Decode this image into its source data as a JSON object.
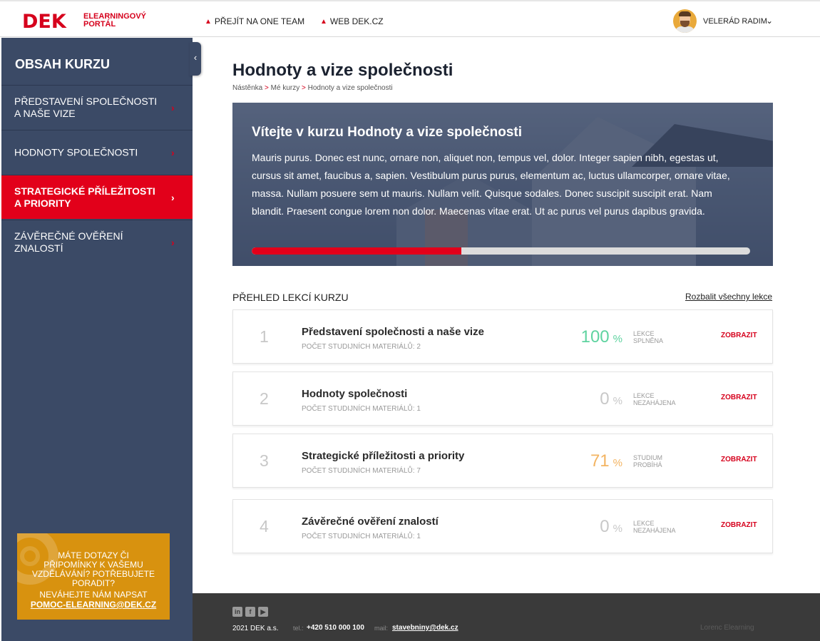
{
  "header": {
    "logo_text": "DEK",
    "portal_line1": "ELEARNINGOVÝ",
    "portal_line2": "PORTÁL",
    "links": [
      {
        "label": "PŘEJÍT NA ONE TEAM",
        "icon": "chevron-up-icon"
      },
      {
        "label": "WEB DEK.CZ",
        "icon": "chevron-up-icon"
      }
    ],
    "user_name": "VELERÁD RADIM",
    "user_menu_icon": "chevron-down-icon"
  },
  "sidebar": {
    "title": "OBSAH KURZU",
    "toggle_icon": "chevron-left-icon",
    "items": [
      {
        "label": "PŘEDSTAVENÍ SPOLEČNOSTI A NAŠE VIZE",
        "active": false
      },
      {
        "label": "HODNOTY SPOLEČNOSTI",
        "active": false
      },
      {
        "label": "STRATEGICKÉ PŘÍLEŽITOSTI A PRIORITY",
        "active": true
      },
      {
        "label": "ZÁVĚREČNÉ OVĚŘENÍ ZNALOSTÍ",
        "active": false
      }
    ],
    "help": {
      "question": "MÁTE DOTAZY ČI PŘIPOMÍNKY K VAŠEMU VZDĚLÁVÁNÍ? POTŘEBUJETE PORADIT?",
      "write_us": "NEVÁHEJTE NÁM NAPSAT",
      "email": "POMOC-ELEARNING@DEK.CZ"
    }
  },
  "main": {
    "title": "Hodnoty a vize společnosti",
    "breadcrumb": [
      "Nástěnka",
      "Mé kurzy",
      "Hodnoty a vize společnosti"
    ],
    "hero": {
      "title": "Vítejte v kurzu Hodnoty a vize společnosti",
      "text": "Mauris purus. Donec est nunc, ornare non, aliquet non, tempus vel, dolor. Integer sapien nibh, egestas ut, cursus sit amet, faucibus a, sapien. Vestibulum purus purus, elementum ac, luctus ullamcorper, ornare vitae, massa. Nullam posuere sem ut mauris. Nullam velit. Quisque sodales. Donec suscipit suscipit erat. Nam blandit. Praesent congue lorem non dolor. Maecenas vitae erat. Ut ac purus vel purus dapibus gravida.",
      "progress": 0.42
    },
    "overview_title": "PŘEHLED LEKCÍ KURZU",
    "expand_label": "Rozbalit všechny lekce",
    "lessons": [
      {
        "num": "1",
        "name": "Představení společnosti a naše vize",
        "count": "POČET STUDIJNÍCH MATERIÁLŮ: 2",
        "pct": "100",
        "pct_sign": "%",
        "status_line1": "LEKCE",
        "status_line2": "SPLNĚNA",
        "color": "#5fd3a0",
        "action": "ZOBRAZIT"
      },
      {
        "num": "2",
        "name": "Hodnoty společnosti",
        "count": "POČET STUDIJNÍCH MATERIÁLŮ: 1",
        "pct": "0",
        "pct_sign": "%",
        "status_line1": "LEKCE",
        "status_line2": "NEZAHÁJENA",
        "color": "#c8c8c8",
        "action": "ZOBRAZIT"
      },
      {
        "num": "3",
        "name": "Strategické příležitosti a priority",
        "count": "POČET STUDIJNÍCH MATERIÁLŮ: 7",
        "pct": "71",
        "pct_sign": "%",
        "status_line1": "STUDIUM",
        "status_line2": "PROBÍHÁ",
        "color": "#f3b462",
        "action": "ZOBRAZIT"
      },
      {
        "num": "4",
        "name": "Závěrečné ověření znalostí",
        "count": "POČET STUDIJNÍCH MATERIÁLŮ: 1",
        "pct": "0",
        "pct_sign": "%",
        "status_line1": "LEKCE",
        "status_line2": "NEZAHÁJENA",
        "color": "#c8c8c8",
        "action": "ZOBRAZIT"
      }
    ]
  },
  "footer": {
    "social_icons": [
      "linkedin-icon",
      "facebook-icon",
      "youtube-icon"
    ],
    "copyright": "2021 DEK a.s.",
    "tel_label": "tel.:",
    "tel": "+420 510 000 100",
    "mail_label": "mail:",
    "mail": "stavebniny@dek.cz",
    "brand": "Lorenc Elearning"
  }
}
